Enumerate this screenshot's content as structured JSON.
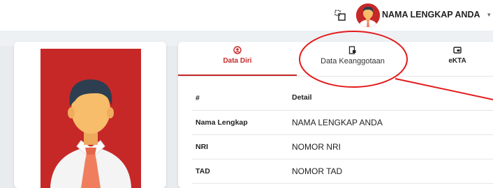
{
  "header": {
    "user_name": "NAMA LENGKAP ANDA",
    "switch_icon": "switch-role-icon",
    "dropdown_icon": "chevron-down-icon"
  },
  "tabs": [
    {
      "label": "Data Diri",
      "icon": "user-circle-icon",
      "active": true
    },
    {
      "label": "Data Keanggotaan",
      "icon": "member-card-icon",
      "active": false
    },
    {
      "label": "eKTA",
      "icon": "id-card-icon",
      "active": false
    }
  ],
  "table": {
    "headers": [
      "#",
      "Detail"
    ],
    "rows": [
      {
        "label": "Nama Lengkap",
        "value": "NAMA LENGKAP ANDA"
      },
      {
        "label": "NRI",
        "value": "NOMOR NRI"
      },
      {
        "label": "TAD",
        "value": "NOMOR TAD"
      }
    ]
  },
  "colors": {
    "accent": "#c62828",
    "annotation": "#e31b1b",
    "background": "#e9ecef"
  }
}
